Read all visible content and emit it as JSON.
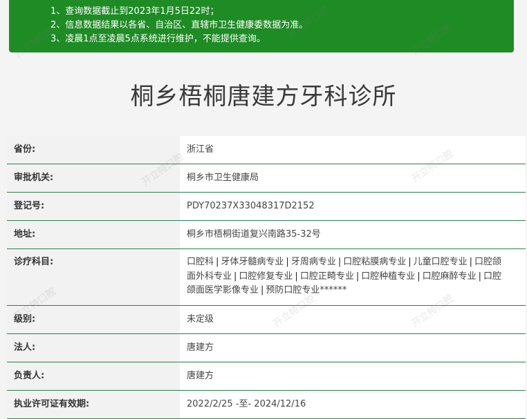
{
  "notice": {
    "lines": [
      "1、查询数据截止到2023年1月5日22时；",
      "2、信息数据结果以各省、自治区、直辖市卫生健康委数据为准。",
      "3、凌晨1点至凌晨5点系统进行维护，不能提供查询。"
    ]
  },
  "title": "桐乡梧桐唐建方牙科诊所",
  "rows": [
    {
      "label": "省份:",
      "value": "浙江省"
    },
    {
      "label": "审批机关:",
      "value": "桐乡市卫生健康局"
    },
    {
      "label": "登记号:",
      "value": "PDY70237X33048317D2152"
    },
    {
      "label": "地址:",
      "value": "桐乡市梧桐街道复兴南路35-32号"
    },
    {
      "label": "诊疗科目:",
      "items": [
        "口腔科",
        "牙体牙髓病专业",
        "牙周病专业",
        "口腔粘膜病专业",
        "儿童口腔专业",
        "口腔颌面外科专业",
        "口腔修复专业",
        "口腔正畸专业",
        "口腔种植专业",
        "口腔麻醉专业",
        "口腔颌面医学影像专业",
        "预防口腔专业******"
      ]
    },
    {
      "label": "级别:",
      "value": "未定级"
    },
    {
      "label": "法人:",
      "value": "唐建方"
    },
    {
      "label": "负责人:",
      "value": "唐建方"
    },
    {
      "label": "执业许可证有效期:",
      "value": "2022/2/25 -至- 2024/12/16"
    }
  ],
  "separator": "|",
  "watermark": "开立特口腔"
}
